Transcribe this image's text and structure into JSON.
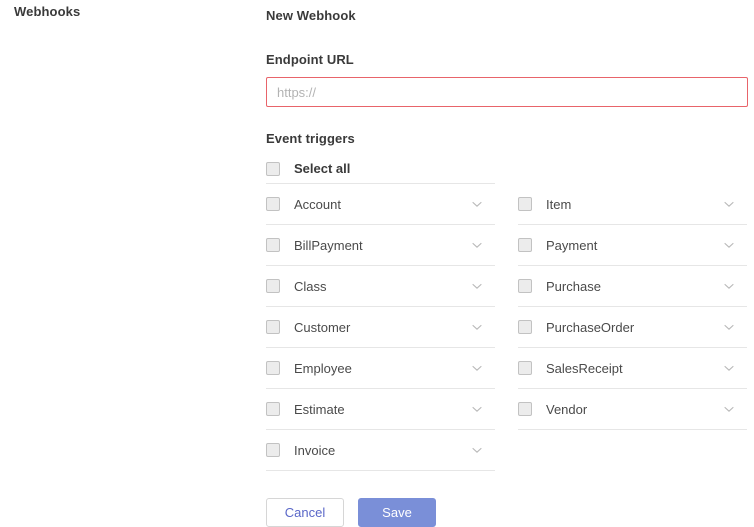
{
  "nav": {
    "heading": "Webhooks"
  },
  "panel": {
    "title": "New Webhook",
    "endpoint": {
      "label": "Endpoint URL",
      "placeholder": "https://",
      "value": "",
      "error_border_color": "#e8646a"
    },
    "triggers": {
      "label": "Event triggers",
      "select_all_label": "Select all",
      "select_all_checked": false,
      "columns": [
        {
          "name": "left",
          "items": [
            {
              "label": "Account",
              "checked": false,
              "expander": "chevron-down-icon"
            },
            {
              "label": "BillPayment",
              "checked": false,
              "expander": "chevron-down-icon"
            },
            {
              "label": "Class",
              "checked": false,
              "expander": "chevron-down-icon"
            },
            {
              "label": "Customer",
              "checked": false,
              "expander": "chevron-down-icon"
            },
            {
              "label": "Employee",
              "checked": false,
              "expander": "chevron-down-icon"
            },
            {
              "label": "Estimate",
              "checked": false,
              "expander": "chevron-down-icon"
            },
            {
              "label": "Invoice",
              "checked": false,
              "expander": "chevron-down-icon"
            }
          ]
        },
        {
          "name": "right",
          "items": [
            {
              "label": "Item",
              "checked": false,
              "expander": "chevron-down-icon"
            },
            {
              "label": "Payment",
              "checked": false,
              "expander": "chevron-down-icon"
            },
            {
              "label": "Purchase",
              "checked": false,
              "expander": "chevron-down-icon"
            },
            {
              "label": "PurchaseOrder",
              "checked": false,
              "expander": "chevron-down-icon"
            },
            {
              "label": "SalesReceipt",
              "checked": false,
              "expander": "chevron-down-icon"
            },
            {
              "label": "Vendor",
              "checked": false,
              "expander": "chevron-down-icon"
            }
          ]
        }
      ]
    },
    "actions": {
      "cancel_label": "Cancel",
      "save_label": "Save",
      "save_color": "#7a8fd8",
      "cancel_text_color": "#5a67c8"
    }
  }
}
